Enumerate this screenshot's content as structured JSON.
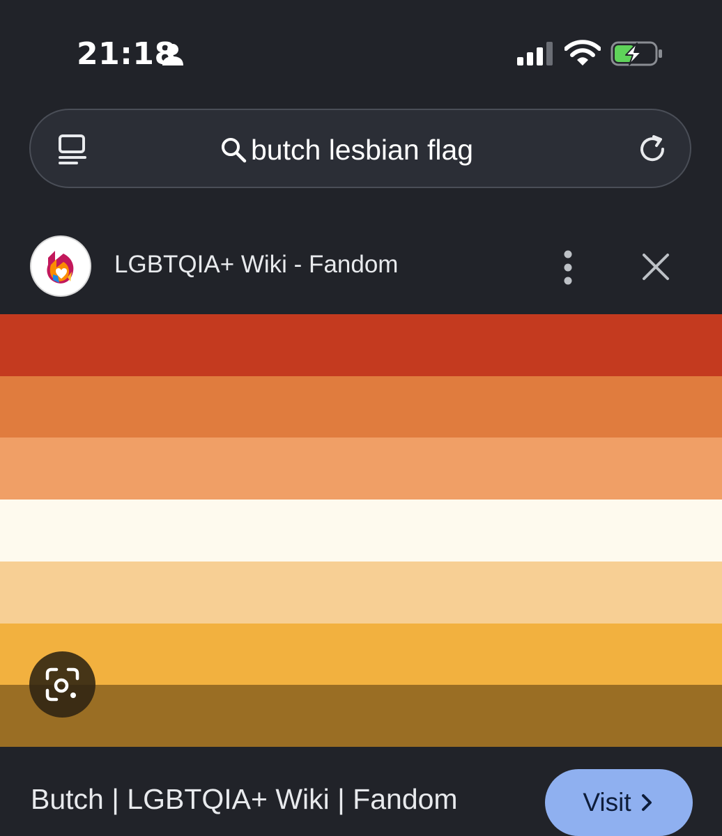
{
  "status_bar": {
    "time": "21:18"
  },
  "search": {
    "query": "butch lesbian flag"
  },
  "source": {
    "name": "LGBTQIA+ Wiki - Fandom"
  },
  "image": {
    "flag_stripes": [
      "#c43a1f",
      "#e07c3e",
      "#f09f66",
      "#fefaee",
      "#f7cf94",
      "#f2b13f",
      "#9a6e24"
    ]
  },
  "result": {
    "title": "Butch | LGBTQIA+ Wiki | Fandom",
    "visit_label": "Visit"
  },
  "colors": {
    "background": "#212329",
    "search_pill": "#2b2e36",
    "visit_button": "#8fb0f0",
    "battery_fill": "#5fd35a"
  },
  "icons": [
    "person-icon",
    "signal-icon",
    "wifi-icon",
    "battery-icon",
    "tabs-icon",
    "search-icon",
    "reload-icon",
    "fandom-logo-icon",
    "more-icon",
    "close-icon",
    "lens-icon",
    "chevron-right-icon"
  ]
}
